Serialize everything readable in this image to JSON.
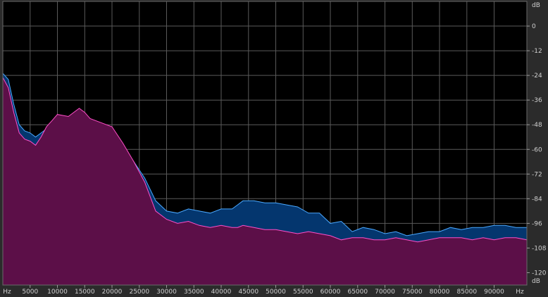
{
  "chart_data": {
    "type": "area",
    "x_unit": "Hz",
    "y_unit": "dB",
    "xlim": [
      0,
      96000
    ],
    "ylim": [
      -126,
      12
    ],
    "x_ticks": [
      5000,
      10000,
      15000,
      20000,
      25000,
      30000,
      35000,
      40000,
      45000,
      50000,
      55000,
      60000,
      65000,
      70000,
      75000,
      80000,
      85000,
      90000
    ],
    "y_ticks": [
      0,
      -12,
      -24,
      -36,
      -48,
      -60,
      -72,
      -84,
      -96,
      -108,
      -120
    ],
    "grid": true,
    "colors": {
      "background": "#000000",
      "grid": "#5a5a5a",
      "ruler": "#2b2b2b",
      "channel_a_fill": "#04366e",
      "channel_a_line": "#4aa8ff",
      "channel_b_fill": "#5c0f48",
      "channel_b_line": "#ff4fc8"
    },
    "series": [
      {
        "x": [
          0,
          1000,
          2000,
          3000,
          4000,
          5000,
          6000,
          7000,
          8000,
          9000,
          10000,
          12000,
          14000,
          15000,
          16000,
          18000,
          20000,
          22000,
          24000,
          26000,
          28000,
          30000,
          32000,
          34000,
          36000,
          38000,
          40000,
          42000,
          43000,
          44000,
          46000,
          48000,
          50000,
          52000,
          54000,
          56000,
          58000,
          60000,
          62000,
          64000,
          66000,
          68000,
          70000,
          72000,
          74000,
          76000,
          78000,
          80000,
          82000,
          84000,
          86000,
          88000,
          90000,
          92000,
          94000,
          96000
        ],
        "y": [
          -23,
          -26,
          -38,
          -48,
          -51,
          -52,
          -54,
          -52,
          -50,
          -48,
          -45,
          -48,
          -47,
          -46,
          -48,
          -50,
          -52,
          -58,
          -66,
          -74,
          -85,
          -90,
          -91,
          -89,
          -90,
          -91,
          -89,
          -89,
          -87,
          -85,
          -85,
          -86,
          -86,
          -87,
          -88,
          -91,
          -91,
          -96,
          -95,
          -100,
          -98,
          -99,
          -101,
          -100,
          -102,
          -101,
          -100,
          -100,
          -98,
          -99,
          -98,
          -98,
          -97,
          -97,
          -98,
          -98
        ]
      },
      {
        "x": [
          0,
          1000,
          2000,
          3000,
          4000,
          5000,
          6000,
          7000,
          8000,
          9000,
          10000,
          12000,
          14000,
          15000,
          16000,
          18000,
          20000,
          22000,
          24000,
          26000,
          28000,
          30000,
          32000,
          34000,
          36000,
          38000,
          40000,
          42000,
          43000,
          44000,
          46000,
          48000,
          50000,
          52000,
          54000,
          56000,
          58000,
          60000,
          62000,
          64000,
          66000,
          68000,
          70000,
          72000,
          74000,
          76000,
          78000,
          80000,
          82000,
          84000,
          86000,
          88000,
          90000,
          92000,
          94000,
          96000
        ],
        "y": [
          -25,
          -30,
          -42,
          -52,
          -55,
          -56,
          -58,
          -54,
          -49,
          -46,
          -43,
          -44,
          -40,
          -42,
          -45,
          -47,
          -49,
          -57,
          -66,
          -76,
          -90,
          -94,
          -96,
          -95,
          -97,
          -98,
          -97,
          -98,
          -98,
          -97,
          -98,
          -99,
          -99,
          -100,
          -101,
          -100,
          -101,
          -102,
          -104,
          -103,
          -103,
          -104,
          -104,
          -103,
          -104,
          -105,
          -104,
          -103,
          -103,
          -103,
          -104,
          -103,
          -104,
          -103,
          -103,
          -104
        ]
      }
    ]
  }
}
